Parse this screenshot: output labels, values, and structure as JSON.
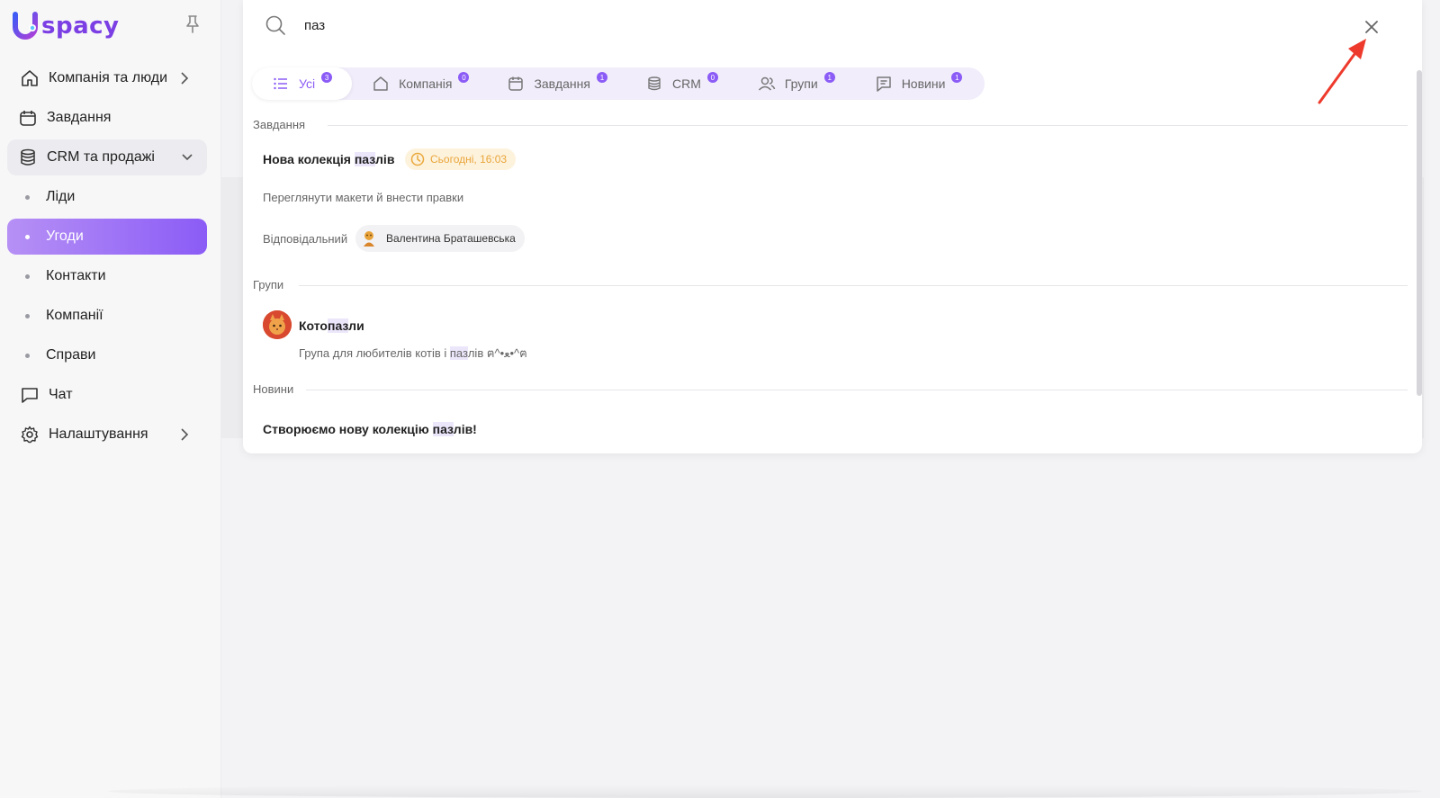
{
  "brand": {
    "logo_letter": "U",
    "logo_text": "spacy",
    "accent": "#8b5cf6"
  },
  "sidebar": {
    "items": [
      {
        "label": "Компанія та люди",
        "icon": "home-icon"
      },
      {
        "label": "Завдання",
        "icon": "calendar-icon"
      },
      {
        "label": "CRM та продажі",
        "icon": "database-icon"
      },
      {
        "label": "Чат",
        "icon": "chat-icon"
      },
      {
        "label": "Налаштування",
        "icon": "gear-icon"
      }
    ],
    "crm_sub": [
      "Ліди",
      "Угоди",
      "Контакти",
      "Компанії",
      "Справи"
    ],
    "active_sub": "Угоди"
  },
  "search": {
    "value": "паз"
  },
  "tabs": [
    {
      "label": "Усі",
      "count": "3",
      "icon": "list-icon"
    },
    {
      "label": "Компанія",
      "count": "0",
      "icon": "home-icon"
    },
    {
      "label": "Завдання",
      "count": "1",
      "icon": "calendar-icon"
    },
    {
      "label": "CRM",
      "count": "0",
      "icon": "database-icon"
    },
    {
      "label": "Групи",
      "count": "1",
      "icon": "users-icon"
    },
    {
      "label": "Новини",
      "count": "1",
      "icon": "message-icon"
    }
  ],
  "results": {
    "tasks": {
      "section": "Завдання",
      "title_pre": "Нова колекція ",
      "title_hl": "паз",
      "title_post": "лів",
      "date": "Сьогодні, 16:03",
      "desc": "Переглянути макети й внести правки",
      "responsible_label": "Відповідальний",
      "responsible_name": "Валентина Браташевська"
    },
    "groups": {
      "section": "Групи",
      "title_pre": "Кото",
      "title_hl": "паз",
      "title_post": "ли",
      "desc_pre": "Група для любителів котів і ",
      "desc_hl": "паз",
      "desc_post": "лів ฅ^•ﻌ•^ฅ"
    },
    "news": {
      "section": "Новини",
      "title_pre": "Створюємо нову колекцію ",
      "title_hl": "паз",
      "title_post": "лів!"
    }
  }
}
